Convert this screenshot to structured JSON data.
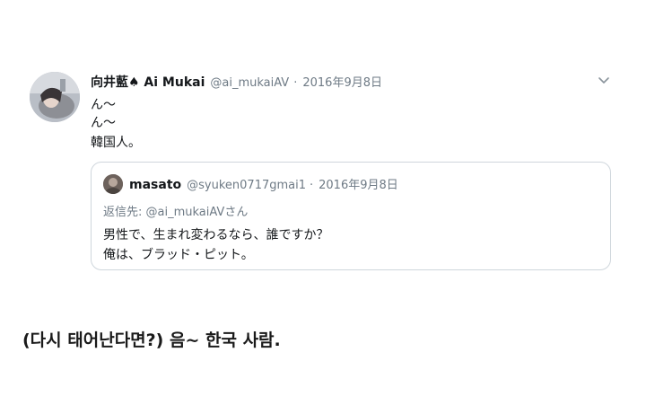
{
  "tweet": {
    "display_name": "向井藍♠ Ai Mukai",
    "handle": "@ai_mukaiAV",
    "separator": "·",
    "date": "2016年9月8日",
    "lines": [
      "ん〜",
      "ん〜",
      "韓国人。"
    ],
    "menu_icon": "chevron-down-icon",
    "avatar_icon": "profile-photo"
  },
  "quoted_tweet": {
    "display_name": "masato",
    "handle": "@syuken0717gmai1",
    "separator": "·",
    "date": "2016年9月8日",
    "reply_to": "返信先: @ai_mukaiAVさん",
    "lines": [
      "男性で、生まれ変わるなら、誰ですか？",
      "俺は、ブラッド・ピット。"
    ]
  },
  "caption": "(다시 태어난다면?) 음~ 한국 사람.",
  "colors": {
    "text": "#14171a",
    "secondary": "#6e7a85",
    "border": "#cfd6dc",
    "background": "#ffffff"
  }
}
